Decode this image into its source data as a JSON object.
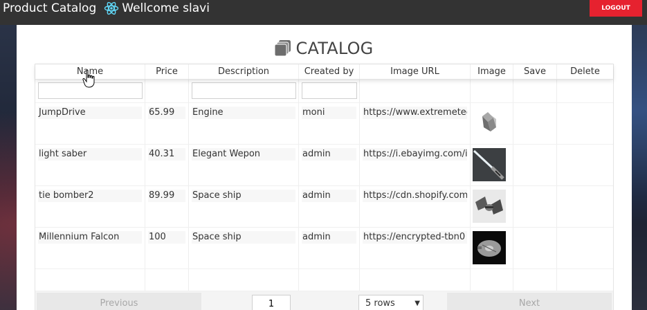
{
  "navbar": {
    "brand": "Product Catalog",
    "welcome": "Wellcome slavi",
    "logout_label": "LOGOUT",
    "logout_color": "#e6222f"
  },
  "catalog": {
    "title": "CATALOG"
  },
  "table": {
    "headers": [
      "Name",
      "Price",
      "Description",
      "Created by",
      "Image URL",
      "Image",
      "Save",
      "Delete"
    ],
    "rows": [
      {
        "name": "JumpDrive",
        "price": "65.99",
        "description": "Engine",
        "created_by": "moni",
        "image_url": "https://www.extremetech.com",
        "image": "jumpdrive-image"
      },
      {
        "name": "light saber",
        "price": "40.31",
        "description": "Elegant Wepon",
        "created_by": "admin",
        "image_url": "https://i.ebayimg.com/images",
        "image": "lightsaber-image"
      },
      {
        "name": "tie bomber2",
        "price": "89.99",
        "description": "Space ship",
        "created_by": "admin",
        "image_url": "https://cdn.shopify.com",
        "image": "tie-bomber-image"
      },
      {
        "name": "Millennium Falcon",
        "price": "100",
        "description": "Space ship",
        "created_by": "admin",
        "image_url": "https://encrypted-tbn0",
        "image": "falcon-image"
      }
    ]
  },
  "pagination": {
    "previous_label": "Previous",
    "next_label": "Next",
    "page": "1",
    "rows_option": "5 rows"
  }
}
